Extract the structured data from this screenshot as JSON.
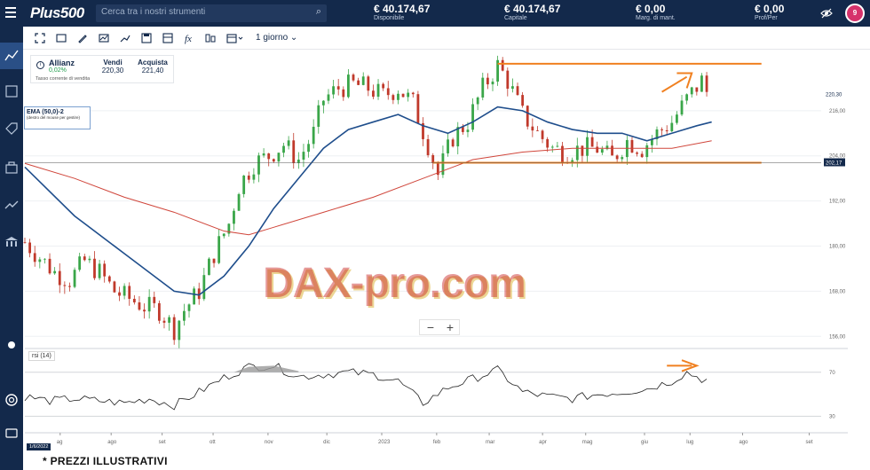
{
  "header": {
    "logo": "Plus500",
    "search_placeholder": "Cerca tra i nostri strumenti",
    "stats": [
      {
        "value": "€ 40.174,67",
        "label": "Disponibile"
      },
      {
        "value": "€ 40.174,67",
        "label": "Capitale"
      },
      {
        "value": "€ 0,00",
        "label": "Marg. di mant."
      },
      {
        "value": "€ 0,00",
        "label": "Prof/Per"
      }
    ],
    "avatar_initial": "9"
  },
  "toolbar": {
    "timeframe": "1 giorno"
  },
  "instrument": {
    "name": "Allianz",
    "change": "0,02%",
    "sell_label": "Vendi",
    "sell_price": "220,30",
    "buy_label": "Acquista",
    "buy_price": "221,40",
    "rate_note": "Tasso corrente di vendita"
  },
  "indicator": {
    "label": "EMA (50,0)-2",
    "hint": "(destro del mouse per gestire)"
  },
  "rsi_label": "rsi (14)",
  "date_badge": "1/6/2022",
  "watermark": "DAX-pro.com",
  "disclaimer": "*  PREZZI ILLUSTRATIVI",
  "colors": {
    "brand_navy": "#13294b",
    "candle_up": "#3aa649",
    "candle_down": "#c0392b",
    "ema50": "#1f4e8c",
    "ema200": "#d0463b",
    "annotation": "#f08020"
  },
  "chart_data": {
    "type": "candlestick",
    "title": "",
    "x_ticks": [
      "ag",
      "ago",
      "set",
      "ott",
      "nov",
      "dic",
      "2023",
      "feb",
      "mar",
      "apr",
      "mag",
      "giu",
      "lug",
      "ago",
      "set"
    ],
    "y_ticks": [
      156.0,
      168.0,
      180.0,
      192.0,
      204.0,
      216.0
    ],
    "ylim": [
      153,
      232
    ],
    "current_price": 220.3,
    "marked_price": 202.17,
    "resistance": 228.5,
    "support": 202.17,
    "price_path": [
      [
        0,
        181
      ],
      [
        3,
        177
      ],
      [
        6,
        173
      ],
      [
        9,
        171
      ],
      [
        12,
        176
      ],
      [
        15,
        173
      ],
      [
        18,
        168
      ],
      [
        21,
        166
      ],
      [
        24,
        164
      ],
      [
        27,
        163
      ],
      [
        30,
        158
      ],
      [
        32,
        163
      ],
      [
        35,
        168
      ],
      [
        38,
        178
      ],
      [
        41,
        186
      ],
      [
        43,
        196
      ],
      [
        46,
        202
      ],
      [
        49,
        204
      ],
      [
        52,
        207
      ],
      [
        55,
        203
      ],
      [
        58,
        210
      ],
      [
        60,
        219
      ],
      [
        63,
        222
      ],
      [
        66,
        223
      ],
      [
        69,
        222
      ],
      [
        72,
        220
      ],
      [
        75,
        222
      ],
      [
        78,
        218
      ],
      [
        81,
        207
      ],
      [
        83,
        199
      ],
      [
        86,
        209
      ],
      [
        89,
        213
      ],
      [
        92,
        222
      ],
      [
        95,
        228
      ],
      [
        97,
        224
      ],
      [
        100,
        215
      ],
      [
        103,
        210
      ],
      [
        106,
        206
      ],
      [
        109,
        205
      ],
      [
        112,
        206
      ],
      [
        115,
        206
      ],
      [
        118,
        203
      ],
      [
        121,
        208
      ],
      [
        124,
        206
      ],
      [
        127,
        210
      ],
      [
        130,
        213
      ],
      [
        133,
        219
      ],
      [
        136,
        224
      ],
      [
        138,
        218
      ]
    ],
    "ema50": [
      [
        0,
        201
      ],
      [
        10,
        188
      ],
      [
        20,
        178
      ],
      [
        30,
        168
      ],
      [
        35,
        167
      ],
      [
        40,
        172
      ],
      [
        45,
        180
      ],
      [
        50,
        190
      ],
      [
        55,
        198
      ],
      [
        60,
        206
      ],
      [
        65,
        211
      ],
      [
        70,
        213
      ],
      [
        75,
        215
      ],
      [
        80,
        212
      ],
      [
        85,
        210
      ],
      [
        90,
        213
      ],
      [
        95,
        217
      ],
      [
        100,
        216
      ],
      [
        105,
        213
      ],
      [
        110,
        211
      ],
      [
        115,
        210
      ],
      [
        120,
        210
      ],
      [
        125,
        208
      ],
      [
        130,
        210
      ],
      [
        135,
        212
      ],
      [
        138,
        213
      ]
    ],
    "ema200": [
      [
        0,
        202
      ],
      [
        10,
        198
      ],
      [
        20,
        193
      ],
      [
        30,
        189
      ],
      [
        40,
        184
      ],
      [
        45,
        183
      ],
      [
        50,
        185
      ],
      [
        60,
        189
      ],
      [
        70,
        193
      ],
      [
        80,
        198
      ],
      [
        90,
        203
      ],
      [
        100,
        205
      ],
      [
        110,
        206
      ],
      [
        120,
        206
      ],
      [
        130,
        206
      ],
      [
        138,
        208
      ]
    ],
    "rsi": {
      "label": "rsi (14)",
      "levels": [
        30,
        70
      ],
      "ylim": [
        15,
        90
      ],
      "values": [
        [
          0,
          48
        ],
        [
          5,
          44
        ],
        [
          10,
          46
        ],
        [
          15,
          44
        ],
        [
          20,
          42
        ],
        [
          25,
          46
        ],
        [
          30,
          40
        ],
        [
          35,
          52
        ],
        [
          40,
          65
        ],
        [
          45,
          75
        ],
        [
          50,
          76
        ],
        [
          55,
          66
        ],
        [
          60,
          68
        ],
        [
          65,
          70
        ],
        [
          70,
          68
        ],
        [
          75,
          62
        ],
        [
          80,
          42
        ],
        [
          85,
          56
        ],
        [
          90,
          64
        ],
        [
          95,
          72
        ],
        [
          100,
          52
        ],
        [
          105,
          48
        ],
        [
          110,
          46
        ],
        [
          115,
          50
        ],
        [
          120,
          52
        ],
        [
          125,
          55
        ],
        [
          130,
          62
        ],
        [
          133,
          70
        ],
        [
          136,
          64
        ],
        [
          138,
          62
        ]
      ]
    }
  }
}
